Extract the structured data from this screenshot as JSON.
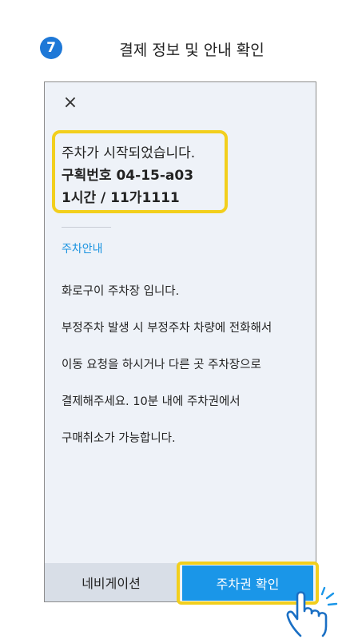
{
  "step": {
    "number": "7",
    "title": "결제 정보 및 안내 확인"
  },
  "screen": {
    "close_glyph": "×",
    "parking_info": {
      "status": "주차가 시작되었습니다.",
      "zone": "구획번호 04-15-a03",
      "duration_plate": "1시간 / 11가1111"
    },
    "guide": {
      "title": "주차안내",
      "lines": [
        "화로구이 주차장 입니다.",
        "부정주차 발생 시 부정주차 차량에 전화해서",
        "이동 요청을 하시거나 다른 곳 주차장으로",
        "결제해주세요. 10분 내에 주차권에서",
        "구매취소가 가능합니다."
      ]
    },
    "buttons": {
      "navigation": "네비게이션",
      "confirm_ticket": "주차권 확인"
    }
  },
  "colors": {
    "accent_blue": "#1a96e8",
    "badge_blue": "#1e78d7",
    "highlight_yellow": "#f2cf1d",
    "screen_bg": "#eef2f8",
    "nav_button_bg": "#d8dee7"
  },
  "icons": {
    "step_badge": "step-number-badge",
    "close": "close-icon",
    "pointer": "hand-pointer-icon"
  }
}
